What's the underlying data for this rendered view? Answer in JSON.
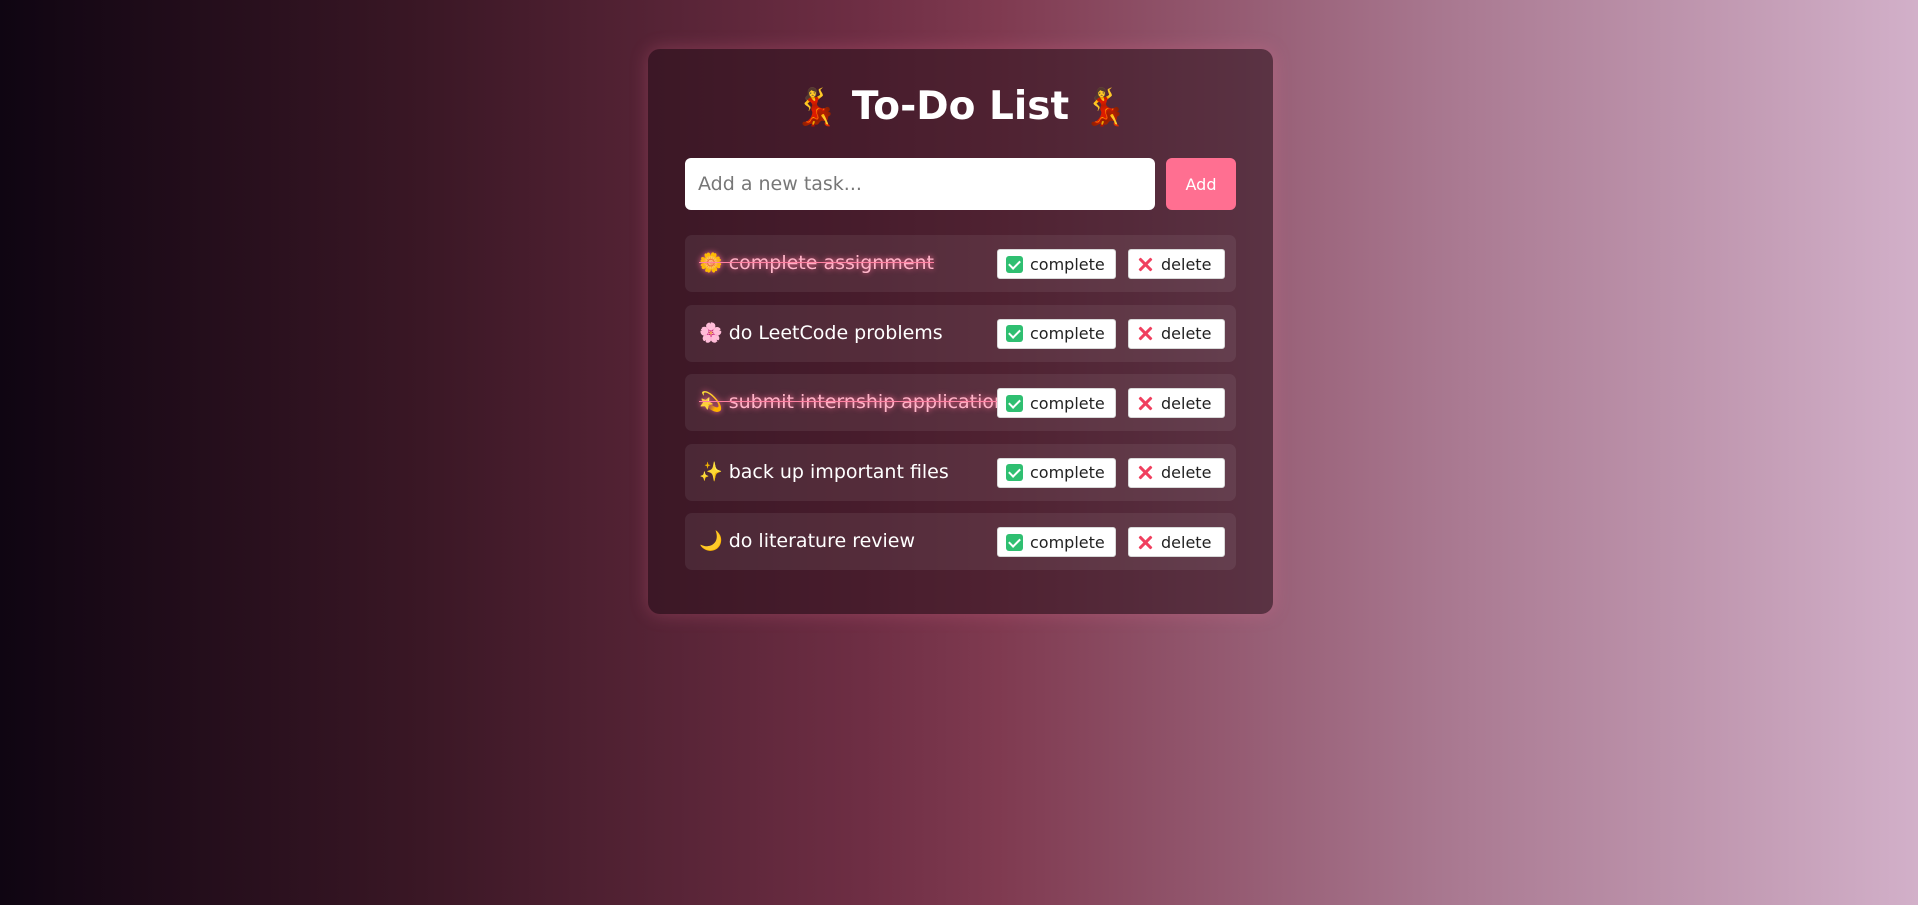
{
  "app": {
    "title_emoji_left": "💃",
    "title": "To-Do List",
    "title_emoji_right": "💃"
  },
  "input": {
    "placeholder": "Add a new task...",
    "value": ""
  },
  "add_button": {
    "label": "Add"
  },
  "tasks": [
    {
      "text": "🌼 complete assignment",
      "completed": true,
      "complete_label": "complete",
      "delete_label": "delete"
    },
    {
      "text": "🌸 do LeetCode problems",
      "completed": false,
      "complete_label": "complete",
      "delete_label": "delete"
    },
    {
      "text": "💫 submit internship application",
      "completed": true,
      "complete_label": "complete",
      "delete_label": "delete"
    },
    {
      "text": "✨ back up important files",
      "completed": false,
      "complete_label": "complete",
      "delete_label": "delete"
    },
    {
      "text": "🌙 do literature review",
      "completed": false,
      "complete_label": "complete",
      "delete_label": "delete"
    }
  ],
  "icons": {
    "complete": "check-box-icon",
    "delete": "cross-mark-icon"
  },
  "colors": {
    "accent": "#ff6f91",
    "completed_text": "#ffb7ca",
    "check_icon": "#2fbf71",
    "cross_icon": "#f0405f"
  }
}
